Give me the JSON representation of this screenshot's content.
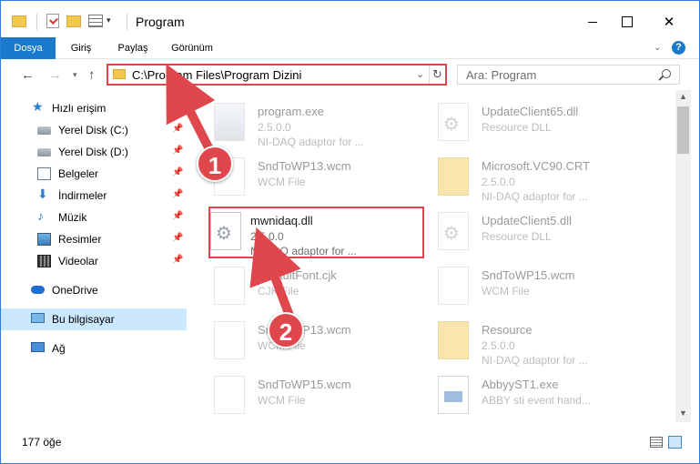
{
  "window": {
    "title": "Program",
    "controls": {
      "minimize": "",
      "maximize": "",
      "close": "✕"
    }
  },
  "ribbon": {
    "tabs": [
      "Dosya",
      "Giriş",
      "Paylaş",
      "Görünüm"
    ],
    "help": "?"
  },
  "address": {
    "path": "C:\\Program Files\\Program Dizini",
    "search_placeholder": "Ara: Program"
  },
  "sidebar": {
    "quick_access": "Hızlı erişim",
    "items": [
      {
        "label": "Yerel Disk (C:)"
      },
      {
        "label": "Yerel Disk (D:)"
      },
      {
        "label": "Belgeler"
      },
      {
        "label": "İndirmeler"
      },
      {
        "label": "Müzik"
      },
      {
        "label": "Resimler"
      },
      {
        "label": "Videolar"
      }
    ],
    "onedrive": "OneDrive",
    "this_pc": "Bu bilgisayar",
    "network": "Ağ"
  },
  "files": {
    "col1": [
      {
        "name": "program.exe",
        "line2": "2.5.0.0",
        "line3": "NI-DAQ adaptor for ..."
      },
      {
        "name": "SndToWP13.wcm",
        "line2": "WCM File",
        "line3": ""
      },
      {
        "name": "mwnidaq.dll",
        "line2": "2.5.0.0",
        "line3": "NI-DAQ adaptor for ..."
      },
      {
        "name": "DefaultFont.cjk",
        "line2": "CJK File",
        "line3": ""
      },
      {
        "name": "SndToWP13.wcm",
        "line2": "WCM File",
        "line3": ""
      },
      {
        "name": "SndToWP15.wcm",
        "line2": "WCM File",
        "line3": ""
      }
    ],
    "col2": [
      {
        "name": "UpdateClient65.dll",
        "line2": "Resource DLL",
        "line3": ""
      },
      {
        "name": "Microsoft.VC90.CRT",
        "line2": "2.5.0.0",
        "line3": "NI-DAQ adaptor for ..."
      },
      {
        "name": "UpdateClient5.dll",
        "line2": "Resource DLL",
        "line3": ""
      },
      {
        "name": "SndToWP15.wcm",
        "line2": "WCM File",
        "line3": ""
      },
      {
        "name": "Resource",
        "line2": "2.5.0.0",
        "line3": "NI-DAQ adaptor for ..."
      },
      {
        "name": "AbbyyST1.exe",
        "line2": "ABBY sti event hand...",
        "line3": ""
      }
    ]
  },
  "status": {
    "count": "177 öğe"
  },
  "annotations": {
    "badge1": "1",
    "badge2": "2"
  },
  "colors": {
    "accent": "#1979ca",
    "highlight": "#e0474c",
    "selected": "#cce8ff"
  }
}
